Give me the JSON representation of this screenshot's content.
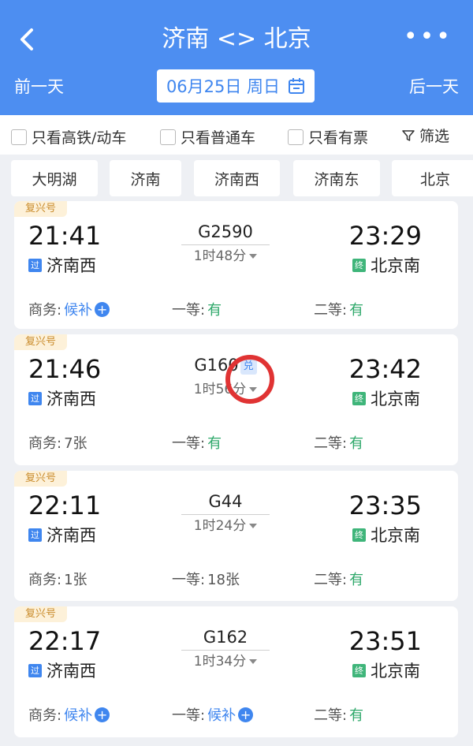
{
  "header": {
    "title": "济南 <> 北京",
    "more": "•••",
    "prev_day": "前一天",
    "next_day": "后一天",
    "date": "06月25日 周日"
  },
  "filters": {
    "high_speed": "只看高铁/动车",
    "normal": "只看普通车",
    "available": "只看有票",
    "filter": "筛选"
  },
  "stations": [
    "大明湖",
    "济南",
    "济南西",
    "济南东",
    "北京"
  ],
  "trains": [
    {
      "tag": "复兴号",
      "dep_time": "21:41",
      "arr_time": "23:29",
      "train_no": "G2590",
      "duration": "1时48分",
      "pass_badge": "过",
      "end_badge": "终",
      "dep_station": "济南西",
      "arr_station": "北京南",
      "business_label": "商务:",
      "business_value": "候补",
      "first_label": "一等:",
      "first_value": "有",
      "second_label": "二等:",
      "second_value": "有"
    },
    {
      "tag": "复兴号",
      "dep_time": "21:46",
      "arr_time": "23:42",
      "train_no": "G160",
      "exchange_badge": "兑",
      "duration": "1时56分",
      "pass_badge": "过",
      "end_badge": "终",
      "dep_station": "济南西",
      "arr_station": "北京南",
      "business_label": "商务:",
      "business_value": "7张",
      "first_label": "一等:",
      "first_value": "有",
      "second_label": "二等:",
      "second_value": "有"
    },
    {
      "tag": "复兴号",
      "dep_time": "22:11",
      "arr_time": "23:35",
      "train_no": "G44",
      "duration": "1时24分",
      "pass_badge": "过",
      "end_badge": "终",
      "dep_station": "济南西",
      "arr_station": "北京南",
      "business_label": "商务:",
      "business_value": "1张",
      "first_label": "一等:",
      "first_value": "18张",
      "second_label": "二等:",
      "second_value": "有"
    },
    {
      "tag": "复兴号",
      "dep_time": "22:17",
      "arr_time": "23:51",
      "train_no": "G162",
      "duration": "1时34分",
      "pass_badge": "过",
      "end_badge": "终",
      "dep_station": "济南西",
      "arr_station": "北京南",
      "business_label": "商务:",
      "business_value": "候补",
      "first_label": "一等:",
      "first_value": "候补",
      "second_label": "二等:",
      "second_value": "有"
    }
  ],
  "colors": {
    "header": "#4d8ef1",
    "accent": "#3f86ef",
    "available": "#2ea86a",
    "highlight_ring": "#e03333"
  }
}
